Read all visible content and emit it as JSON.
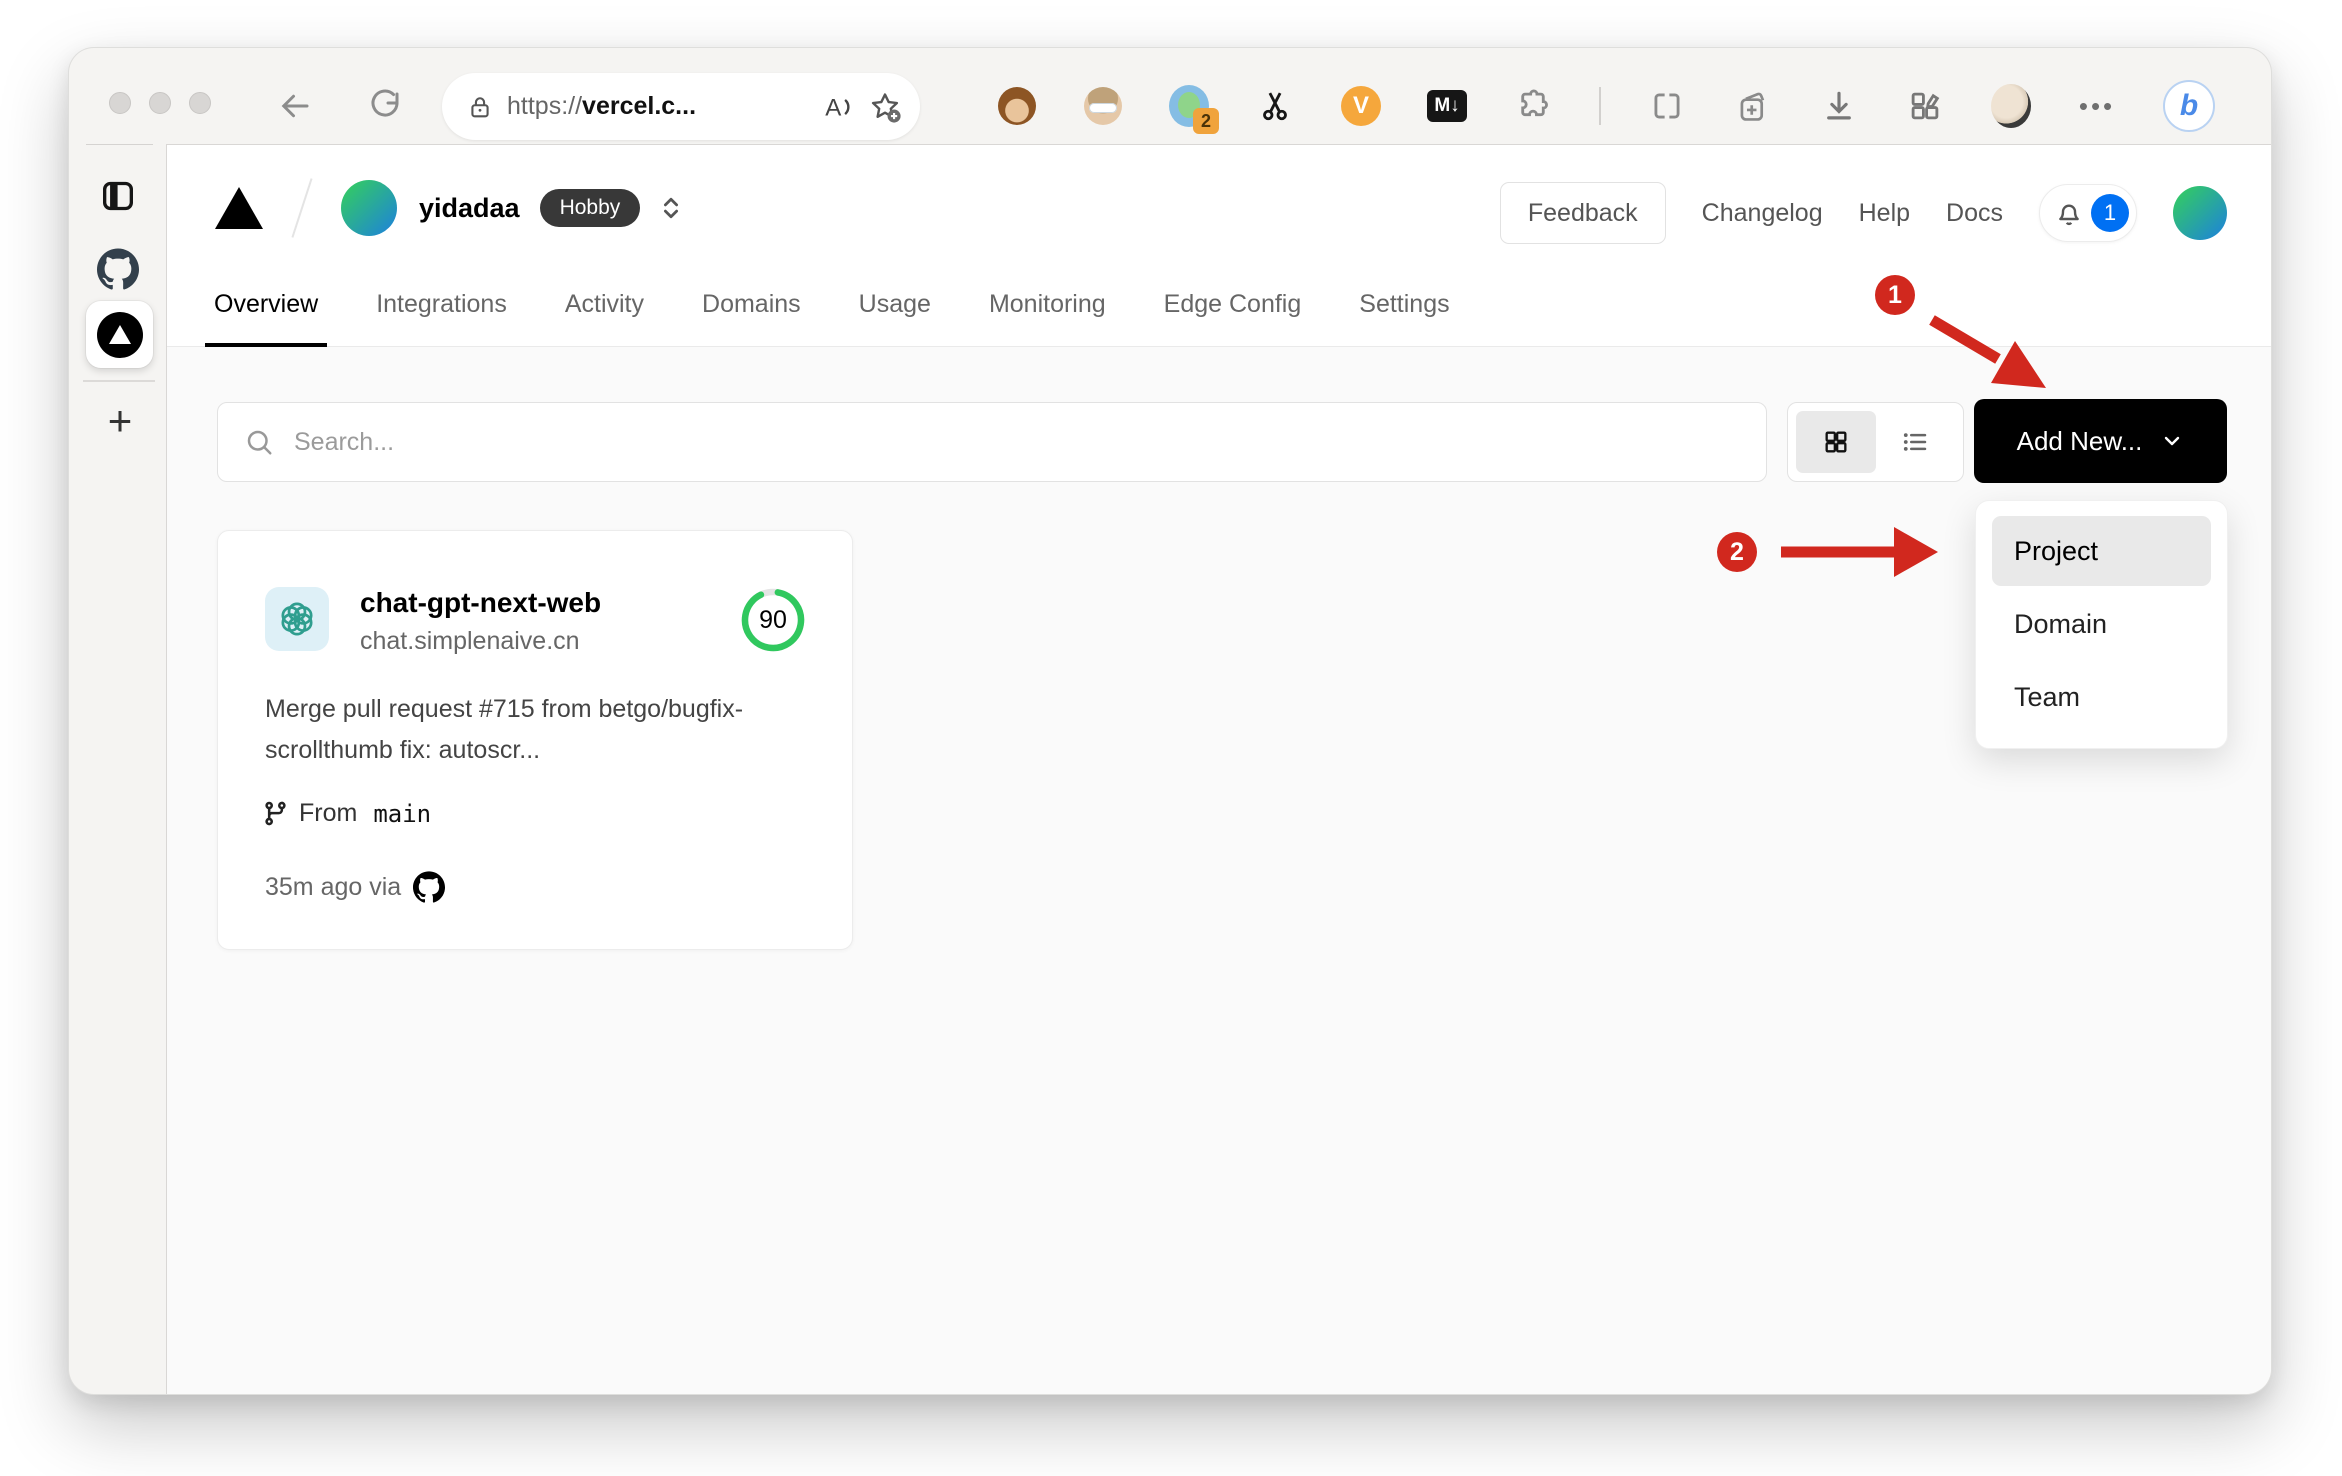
{
  "browser": {
    "url": {
      "scheme": "https://",
      "domain": "vercel.c..."
    },
    "read_aloud_label": "A",
    "extension_badge_count": "2",
    "vimium_ext_label": "V",
    "markdown_ext_label": "M↓",
    "more_menu_glyph": "•••",
    "bing_label": "b"
  },
  "browser_sidebar": {
    "new_tab_glyph": "+"
  },
  "header": {
    "team_name": "yidadaa",
    "plan_badge": "Hobby",
    "feedback_button": "Feedback",
    "nav_links": [
      "Changelog",
      "Help",
      "Docs"
    ],
    "notification_count": "1"
  },
  "tabs": {
    "items": [
      {
        "label": "Overview"
      },
      {
        "label": "Integrations"
      },
      {
        "label": "Activity"
      },
      {
        "label": "Domains"
      },
      {
        "label": "Usage"
      },
      {
        "label": "Monitoring"
      },
      {
        "label": "Edge Config"
      },
      {
        "label": "Settings"
      }
    ]
  },
  "controls": {
    "search_placeholder": "Search...",
    "add_new_label": "Add New..."
  },
  "dropdown": {
    "items": [
      {
        "label": "Project"
      },
      {
        "label": "Domain"
      },
      {
        "label": "Team"
      }
    ]
  },
  "project_card": {
    "name": "chat-gpt-next-web",
    "domain": "chat.simplenaive.cn",
    "score": "90",
    "commit_message": "Merge pull request #715 from betgo/bugfix-scrollthumb fix: autoscr...",
    "branch_label": "From",
    "branch_name": "main",
    "updated": "35m ago via"
  },
  "annotations": {
    "step_1": "1",
    "step_2": "2"
  },
  "colors": {
    "accent_red": "#d1281e",
    "notification_blue": "#0070f3",
    "score_green": "#30c85e",
    "openai_teal": "#2f9e8f",
    "card_icon_bg": "#def0f7"
  }
}
